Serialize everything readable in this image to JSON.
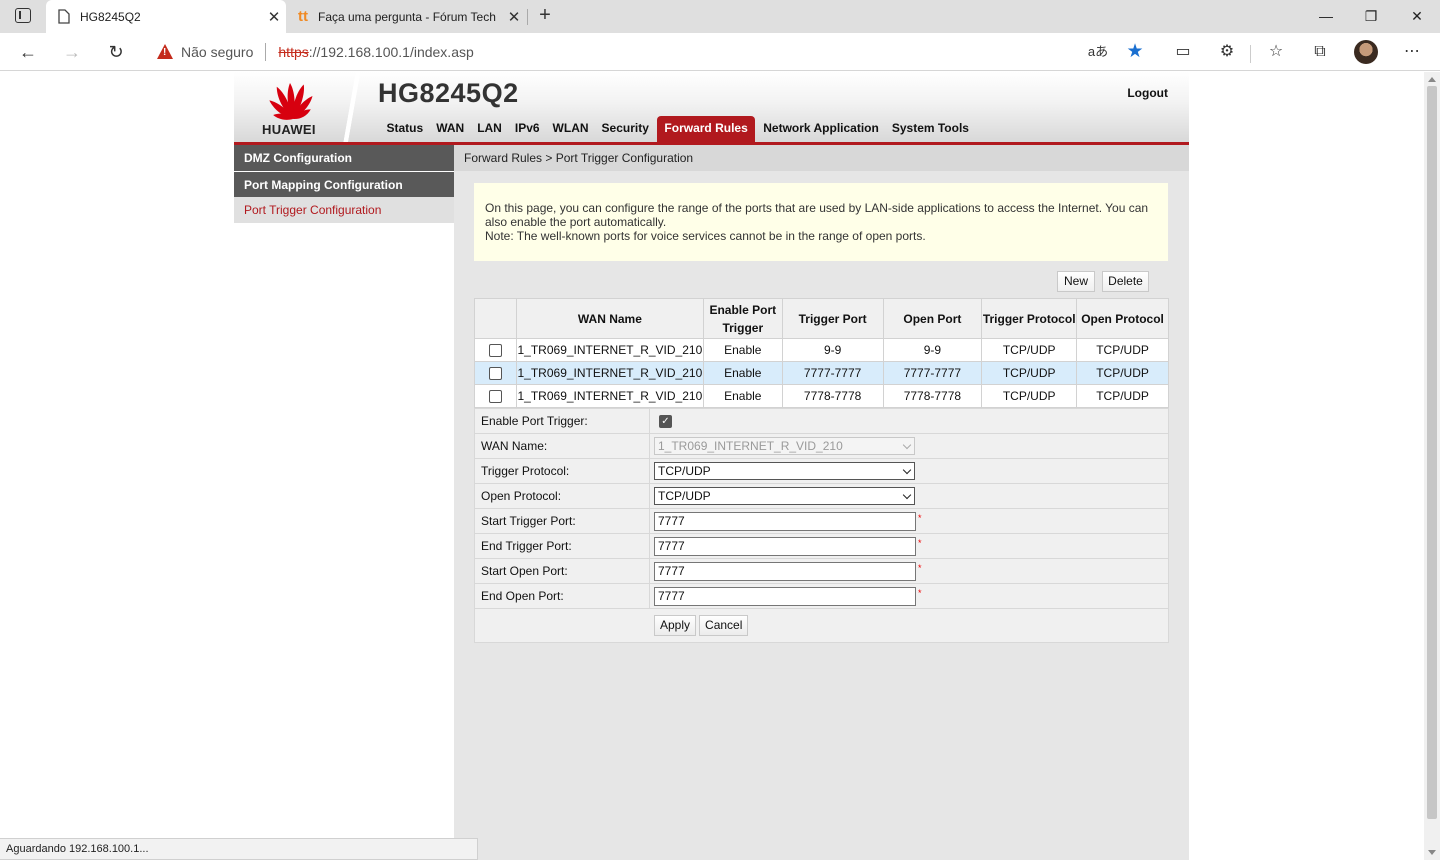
{
  "browser": {
    "tabs": [
      {
        "title": "HG8245Q2",
        "active": true
      },
      {
        "title": "Faça uma pergunta - Fórum Tech",
        "active": false
      }
    ],
    "security_label": "Não seguro",
    "url_scheme": "https",
    "url_rest": "://192.168.100.1/index.asp",
    "status_text": "Aguardando 192.168.100.1..."
  },
  "router": {
    "brand": "HUAWEI",
    "model": "HG8245Q2",
    "logout": "Logout",
    "menu": [
      "Status",
      "WAN",
      "LAN",
      "IPv6",
      "WLAN",
      "Security",
      "Forward Rules",
      "Network Application",
      "System Tools"
    ],
    "active_menu": "Forward Rules",
    "brand_color": "#b1191e"
  },
  "sidebar": {
    "items": [
      "DMZ Configuration",
      "Port Mapping Configuration",
      "Port Trigger Configuration"
    ],
    "current": "Port Trigger Configuration"
  },
  "breadcrumb": "Forward Rules > Port Trigger Configuration",
  "notice": {
    "line1": "On this page, you can configure the range of the ports that are used by LAN-side applications to access the Internet. You can also enable the port automatically.",
    "line2": "Note: The well-known ports for voice services cannot be in the range of open ports."
  },
  "buttons": {
    "new": "New",
    "delete": "Delete",
    "apply": "Apply",
    "cancel": "Cancel"
  },
  "table": {
    "headers": [
      "WAN Name",
      "Enable Port Trigger",
      "Trigger Port",
      "Open Port",
      "Trigger Protocol",
      "Open Protocol"
    ],
    "rows": [
      [
        "1_TR069_INTERNET_R_VID_210",
        "Enable",
        "9-9",
        "9-9",
        "TCP/UDP",
        "TCP/UDP"
      ],
      [
        "1_TR069_INTERNET_R_VID_210",
        "Enable",
        "7777-7777",
        "7777-7777",
        "TCP/UDP",
        "TCP/UDP"
      ],
      [
        "1_TR069_INTERNET_R_VID_210",
        "Enable",
        "7778-7778",
        "7778-7778",
        "TCP/UDP",
        "TCP/UDP"
      ]
    ],
    "selected_row": 1
  },
  "form": {
    "enable_label": "Enable Port Trigger:",
    "enable_checked": true,
    "wan_label": "WAN Name:",
    "wan_value": "1_TR069_INTERNET_R_VID_210",
    "trigger_protocol_label": "Trigger Protocol:",
    "trigger_protocol_value": "TCP/UDP",
    "open_protocol_label": "Open Protocol:",
    "open_protocol_value": "TCP/UDP",
    "start_trigger_label": "Start Trigger Port:",
    "start_trigger_value": "7777",
    "end_trigger_label": "End Trigger Port:",
    "end_trigger_value": "7777",
    "start_open_label": "Start Open Port:",
    "start_open_value": "7777",
    "end_open_label": "End Open Port:",
    "end_open_value": "7777",
    "required_mark": "*"
  }
}
